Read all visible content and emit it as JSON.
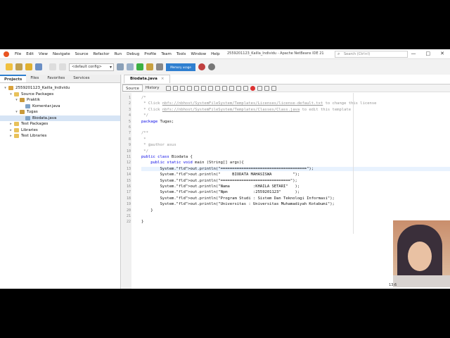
{
  "window": {
    "title": "2559201123_Kailla_Individu - Apache NetBeans IDE 21",
    "search_placeholder": "Search (Ctrl+I)",
    "controls": [
      "—",
      "□",
      "✕"
    ]
  },
  "menu": [
    "File",
    "Edit",
    "View",
    "Navigate",
    "Source",
    "Refactor",
    "Run",
    "Debug",
    "Profile",
    "Team",
    "Tools",
    "Window",
    "Help"
  ],
  "toolbar": {
    "config_label": "<default config>",
    "memory_label": "Memory usage"
  },
  "left_panel": {
    "tabs": [
      "Projects",
      "Files",
      "Favorites",
      "Services"
    ],
    "tree": [
      {
        "label": "2559201123_Kailla_Individu",
        "depth": 0,
        "icon": "project-icon"
      },
      {
        "label": "Source Packages",
        "depth": 1,
        "icon": "folder-icon"
      },
      {
        "label": "Praktik",
        "depth": 2,
        "icon": "package-icon"
      },
      {
        "label": "Komentar.java",
        "depth": 3,
        "icon": "java-file-icon"
      },
      {
        "label": "Tugas",
        "depth": 2,
        "icon": "package-icon"
      },
      {
        "label": "Biodata.java",
        "depth": 3,
        "icon": "java-file-icon"
      },
      {
        "label": "Test Packages",
        "depth": 1,
        "icon": "folder-icon"
      },
      {
        "label": "Libraries",
        "depth": 1,
        "icon": "folder-icon"
      },
      {
        "label": "Test Libraries",
        "depth": 1,
        "icon": "folder-icon"
      }
    ]
  },
  "editor": {
    "file_tab": "Biodata.java",
    "view_tabs": [
      "Source",
      "History"
    ],
    "lines": [
      {
        "n": "1",
        "text": "/*",
        "cls": "cm"
      },
      {
        "n": "2",
        "text": " * Click nbfs://nbhost/SystemFileSystem/Templates/Licenses/license-default.txt to change this license",
        "cls": "cm"
      },
      {
        "n": "3",
        "text": " * Click nbfs://nbhost/SystemFileSystem/Templates/Classes/Class.java to edit this template",
        "cls": "cm"
      },
      {
        "n": "4",
        "text": " */",
        "cls": "cm"
      },
      {
        "n": "5",
        "text": "package Tugas;",
        "cls": "pkg"
      },
      {
        "n": "6",
        "text": "",
        "cls": ""
      },
      {
        "n": "7",
        "text": "/**",
        "cls": "cm"
      },
      {
        "n": "8",
        "text": " *",
        "cls": "cm"
      },
      {
        "n": "9",
        "text": " * @author asus",
        "cls": "cm"
      },
      {
        "n": "10",
        "text": " */",
        "cls": "cm"
      },
      {
        "n": "11",
        "text": "public class Biodata {",
        "cls": "cls"
      },
      {
        "n": "12",
        "text": "    public static void main (String[] args){",
        "cls": "main"
      },
      {
        "n": "13",
        "text": "        System.out.println(\"=====================================\");",
        "cls": "print"
      },
      {
        "n": "14",
        "text": "        System.out.println(\"     BIODATA MAHASISWA         \");",
        "cls": "print"
      },
      {
        "n": "15",
        "text": "        System.out.println(\"==============================\");",
        "cls": "print"
      },
      {
        "n": "16",
        "text": "        System.out.println(\"Nama          :KHAILA SETARI\"   );",
        "cls": "print"
      },
      {
        "n": "17",
        "text": "        System.out.println(\"Npm           :2559201123\"      );",
        "cls": "print"
      },
      {
        "n": "18",
        "text": "        System.out.println(\"Program Studi : Sistem Dan Teknologi Informasi\");",
        "cls": "print"
      },
      {
        "n": "19",
        "text": "        System.out.println(\"Universitas : Universitas Muhamadiyah Kotabumi\");",
        "cls": "print"
      },
      {
        "n": "20",
        "text": "    }",
        "cls": ""
      },
      {
        "n": "21",
        "text": "",
        "cls": ""
      },
      {
        "n": "22",
        "text": "}",
        "cls": ""
      }
    ]
  },
  "status": {
    "caret": "13:6"
  },
  "colors": {
    "accent": "#2f7fd0",
    "keyword": "#0000e6",
    "string": "#ce7b00",
    "comment": "#969696"
  }
}
